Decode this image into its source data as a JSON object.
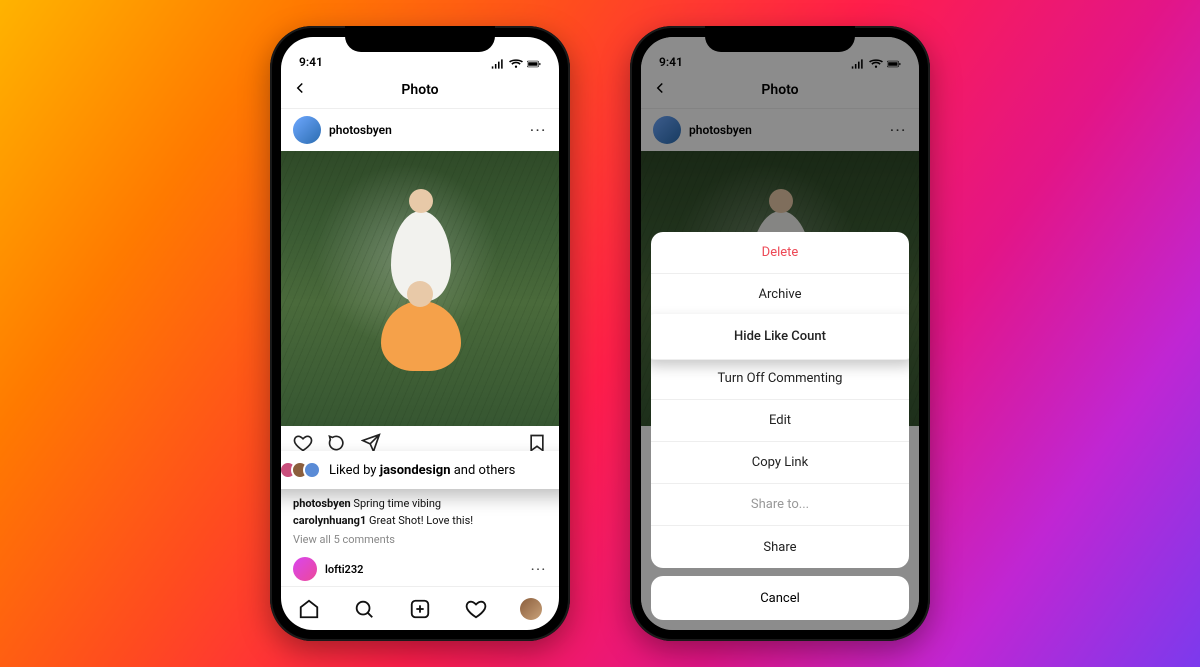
{
  "status": {
    "time": "9:41"
  },
  "nav": {
    "title": "Photo"
  },
  "post": {
    "username": "photosbyen",
    "liked_prefix": "Liked by ",
    "liked_user": "jasondesign",
    "liked_suffix": " and others",
    "caption_user": "photosbyen",
    "caption_text": " Spring time vibing",
    "comment_user": "carolynhuang1",
    "comment_text": " Great Shot! Love this!",
    "view_all": "View all 5 comments",
    "commenter2": "lofti232"
  },
  "sheet": {
    "items": [
      {
        "label": "Delete",
        "kind": "destructive"
      },
      {
        "label": "Archive",
        "kind": "normal"
      },
      {
        "label": "Hide Like Count",
        "kind": "highlight"
      },
      {
        "label": "Turn Off Commenting",
        "kind": "normal"
      },
      {
        "label": "Edit",
        "kind": "normal"
      },
      {
        "label": "Copy Link",
        "kind": "normal"
      },
      {
        "label": "Share to...",
        "kind": "muted"
      },
      {
        "label": "Share",
        "kind": "normal"
      }
    ],
    "cancel": "Cancel"
  }
}
